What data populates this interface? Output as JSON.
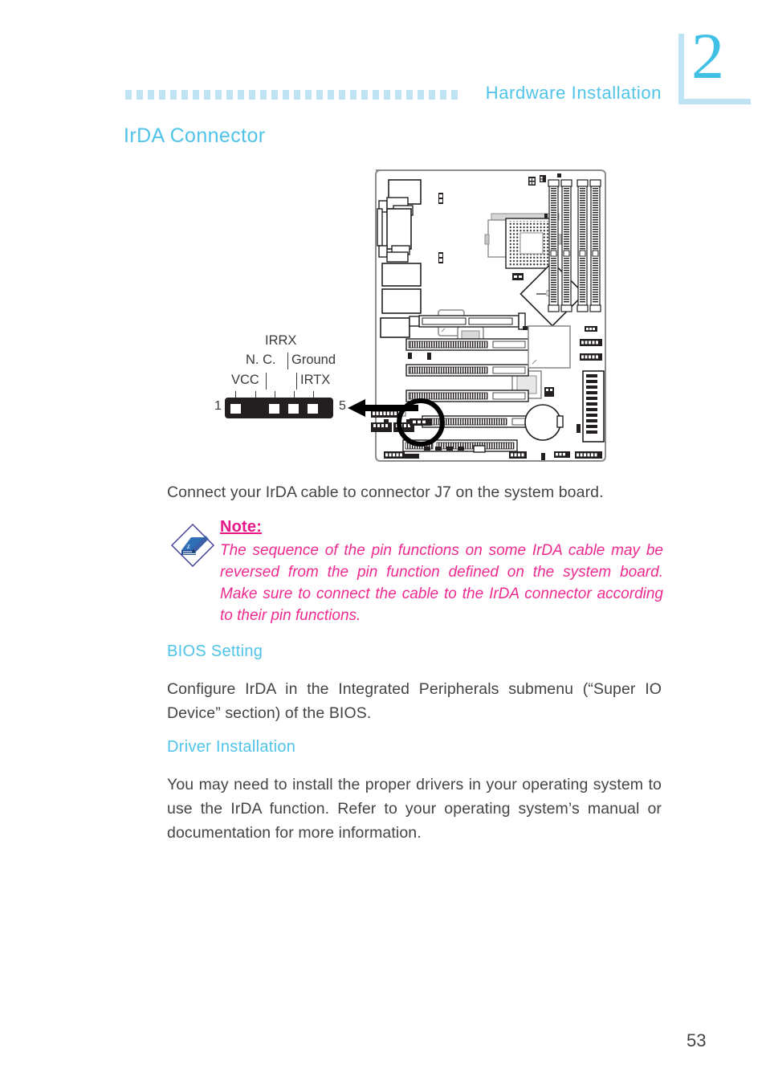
{
  "header": {
    "chapter_number": "2",
    "title": "Hardware  Installation",
    "dots_icon": "dotted-rule",
    "accent_color": "#4fc3e8",
    "accent_light_color": "#bfe3f2"
  },
  "section": {
    "title": "IrDA Connector"
  },
  "diagram": {
    "name": "irda-connector-pinout",
    "pin_labels": [
      {
        "id": "irrx",
        "text": "IRRX"
      },
      {
        "id": "nc",
        "text": "N. C."
      },
      {
        "id": "ground",
        "text": "Ground"
      },
      {
        "id": "vcc",
        "text": "VCC"
      },
      {
        "id": "irtx",
        "text": "IRTX"
      }
    ],
    "pin_numbers": {
      "first": "1",
      "last": "5"
    },
    "connector_color": "#231f20",
    "board_caption": "",
    "callout": "arrow-to-board-connector"
  },
  "content": {
    "intro": "Connect your IrDA cable to connector J7 on the system board.",
    "note": {
      "icon": "note-diamond-icon",
      "title": "Note:",
      "text": "The sequence of the pin functions on some IrDA cable may be reversed from the pin function defined on the system board. Make sure to connect the cable to the IrDA connector according to their pin functions.",
      "color": "#ee2a8f"
    },
    "bios_setting": {
      "heading": "BIOS  Setting",
      "paragraph": "Configure IrDA in the Integrated Peripherals submenu (“Super IO Device” section) of the BIOS."
    },
    "driver_installation": {
      "heading": "Driver  Installation",
      "paragraph": "You may need to install the proper drivers in your operating system to use the IrDA function. Refer to your operating system’s manual or documentation for more information."
    }
  },
  "footer": {
    "page_number": "53"
  }
}
